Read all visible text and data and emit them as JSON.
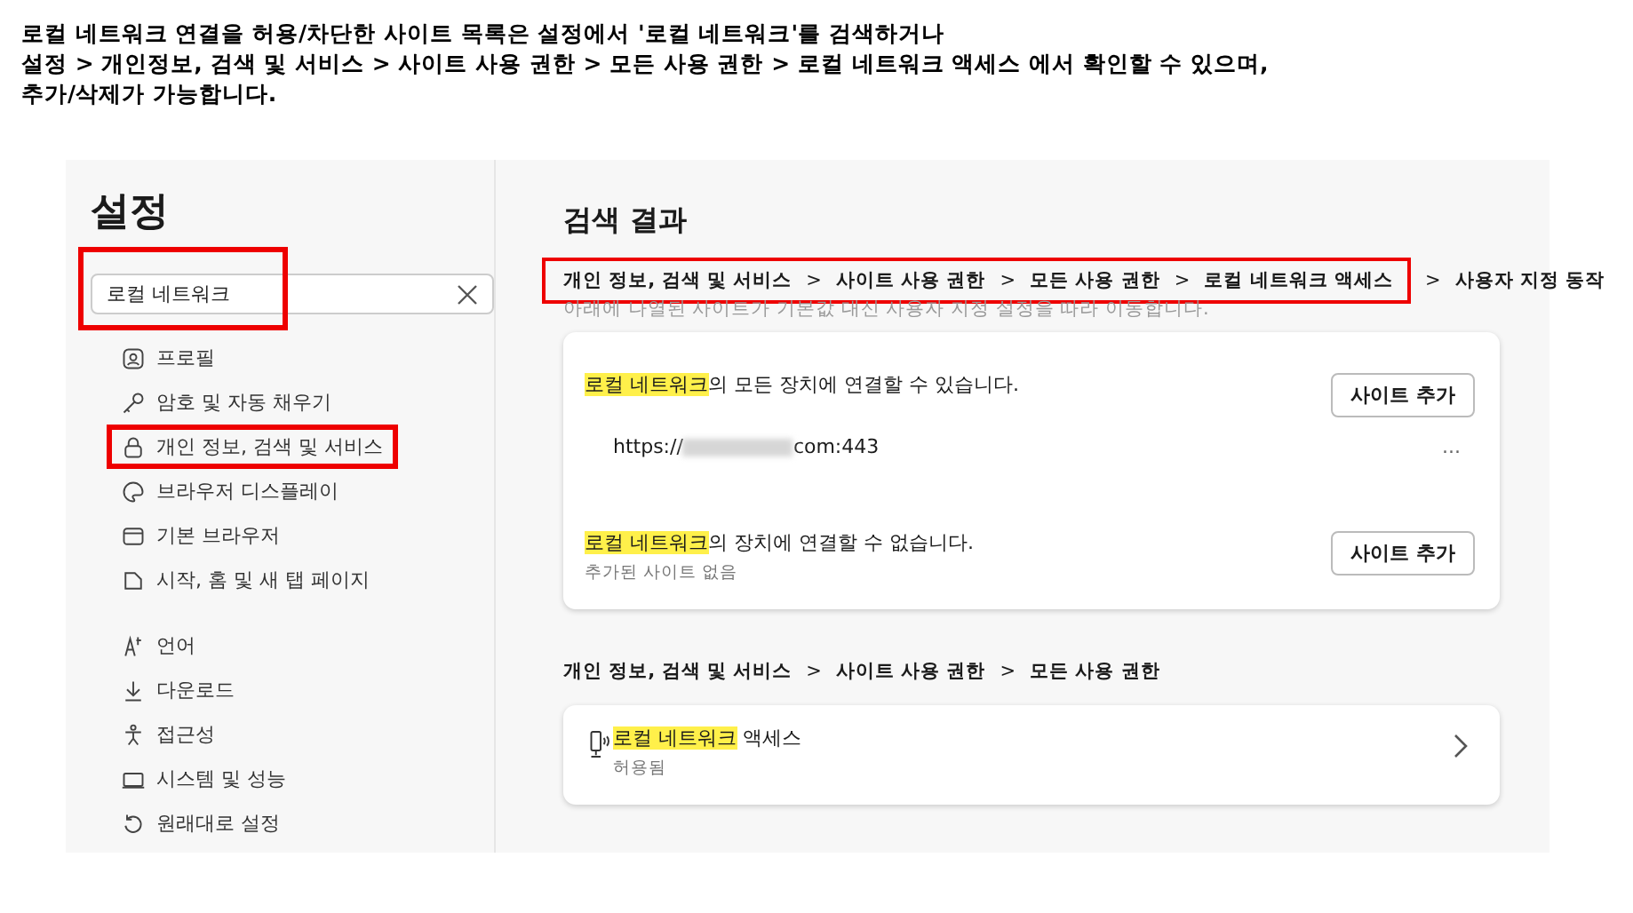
{
  "caption": [
    "로컬 네트워크 연결을 허용/차단한 사이트 목록은 설정에서 '로컬 네트워크'를 검색하거나",
    "설정 > 개인정보, 검색 및 서비스 > 사이트 사용 권한 > 모든 사용 권한 > 로컬 네트워크 액세스 에서 확인할 수 있으며,",
    "추가/삭제가 가능합니다."
  ],
  "sidebar": {
    "title": "설정",
    "search": {
      "value": "로컬 네트워크",
      "annotated": true
    },
    "groups": [
      [
        {
          "label": "프로필",
          "annotated": false
        },
        {
          "label": "암호 및 자동 채우기",
          "annotated": false
        },
        {
          "label": "개인 정보, 검색 및 서비스",
          "annotated": true
        },
        {
          "label": "브라우저 디스플레이",
          "annotated": false
        },
        {
          "label": "기본 브라우저",
          "annotated": false
        },
        {
          "label": "시작, 홈 및 새 탭 페이지",
          "annotated": false
        }
      ],
      [
        {
          "label": "언어",
          "annotated": false
        },
        {
          "label": "다운로드",
          "annotated": false
        },
        {
          "label": "접근성",
          "annotated": false
        },
        {
          "label": "시스템 및 성능",
          "annotated": false
        },
        {
          "label": "원래대로 설정",
          "annotated": false
        }
      ]
    ]
  },
  "main": {
    "title": "검색 결과",
    "breadcrumb": [
      {
        "label": "개인 정보, 검색 및 서비스",
        "annotated": true
      },
      {
        "sep": ">",
        "label": "사이트 사용 권한",
        "annotated": true
      },
      {
        "sep": ">",
        "label": "모든 사용 권한",
        "annotated": true
      },
      {
        "sep": ">",
        "label": "로컬 네트워크 액세스",
        "annotated": true
      },
      {
        "sep": ">",
        "label": "사용자 지정 동작",
        "annotated": false
      }
    ],
    "description": "아래에 나열된 사이트가 기본값 대신 사용자 지정 설정을 따라 이동합니다.",
    "sections": [
      {
        "highlight": "로컬 네트워크",
        "text": "의 모든 장치에 연결할 수 있습니다.",
        "button": "사이트 추가",
        "sites": [
          {
            "url_prefix": "https://",
            "url_suffix": "com:443",
            "more": "..."
          }
        ]
      },
      {
        "highlight": "로컬 네트워크",
        "text": "의 장치에 연결할 수 없습니다.",
        "button": "사이트 추가",
        "empty": "추가된 사이트 없음"
      }
    ],
    "second_breadcrumb": [
      {
        "label": "개인 정보, 검색 및 서비스"
      },
      {
        "sep": ">",
        "label": "사이트 사용 권한"
      },
      {
        "sep": ">",
        "label": "모든 사용 권한"
      }
    ],
    "second_card": {
      "highlight": "로컬 네트워크",
      "text": " 액세스",
      "status": "허용됨"
    }
  }
}
